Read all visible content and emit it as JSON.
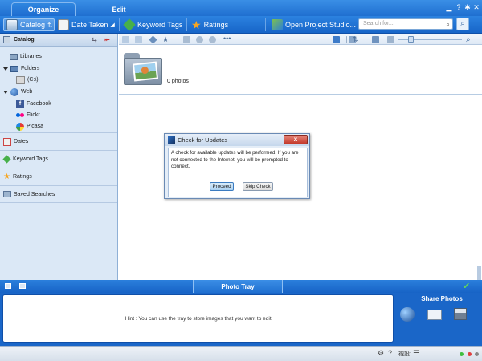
{
  "app": {
    "tabs": [
      {
        "label": "Organize",
        "active": true
      },
      {
        "label": "Edit",
        "active": false
      }
    ],
    "window_controls": [
      "minimize",
      "help",
      "settings",
      "close"
    ]
  },
  "toolbar": {
    "catalog_label": "Catalog",
    "date_taken_label": "Date Taken",
    "keyword_tags_label": "Keyword Tags",
    "ratings_label": "Ratings",
    "open_project_label": "Open Project Studio...",
    "search_placeholder": "Search for..."
  },
  "sidebar": {
    "header": "Catalog",
    "tree": [
      {
        "label": "Libraries",
        "icon": "libraries-icon"
      },
      {
        "label": "Folders",
        "icon": "folders-icon"
      },
      {
        "label": "(C:\\)",
        "icon": "drive-icon"
      },
      {
        "label": "Web",
        "icon": "web-icon"
      },
      {
        "label": "Facebook",
        "icon": "facebook-icon"
      },
      {
        "label": "Flickr",
        "icon": "flickr-icon"
      },
      {
        "label": "Picasa",
        "icon": "picasa-icon"
      }
    ],
    "sections": [
      {
        "label": "Dates",
        "icon": "calendar-icon"
      },
      {
        "label": "Keyword Tags",
        "icon": "tag-icon"
      },
      {
        "label": "Ratings",
        "icon": "star-icon"
      },
      {
        "label": "Saved Searches",
        "icon": "saved-search-icon"
      }
    ]
  },
  "content": {
    "folder_photo_count": "0 photos"
  },
  "dialog": {
    "title": "Check for Updates",
    "close_label": "x",
    "message": "A check for available updates will be performed. If you are not connected to the Internet, you will be prompted to connect.",
    "proceed_label": "Proceed",
    "skip_label": "Skip Check"
  },
  "tray": {
    "title": "Photo Tray",
    "hint": "Hint : You can use the tray to store images that you want to edit.",
    "share_title": "Share Photos"
  },
  "statusbar": {
    "view_text": "視設:"
  },
  "colors": {
    "accent": "#1f6fd0",
    "sidebar_bg": "#dbe8f6",
    "dialog_close": "#c3382a"
  }
}
